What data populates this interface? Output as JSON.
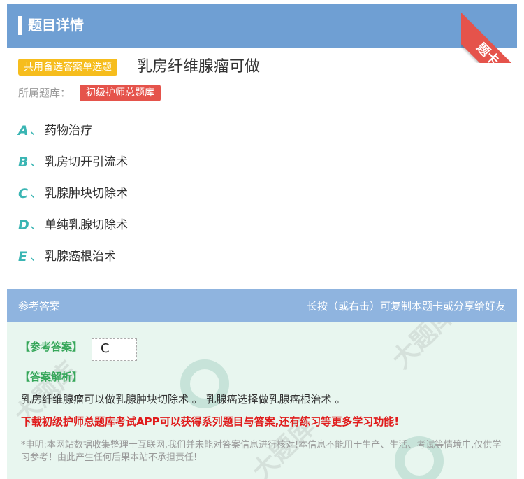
{
  "header": {
    "title": "题目详情",
    "corner_badge": "题卡"
  },
  "question": {
    "type_tag": "共用备选答案单选题",
    "title": "乳房纤维腺瘤可做",
    "bank_label": "所属题库：",
    "bank_name": "初级护师总题库"
  },
  "options": [
    {
      "letter": "A",
      "sep": "、",
      "text": "药物治疗"
    },
    {
      "letter": "B",
      "sep": "、",
      "text": "乳房切开引流术"
    },
    {
      "letter": "C",
      "sep": "、",
      "text": "乳腺肿块切除术"
    },
    {
      "letter": "D",
      "sep": "、",
      "text": "单纯乳腺切除术"
    },
    {
      "letter": "E",
      "sep": "、",
      "text": "乳腺癌根治术"
    }
  ],
  "answer_section": {
    "header_left": "参考答案",
    "header_right": "长按（或右击）可复制本题卡或分享给好友",
    "answer_label": "【参考答案】",
    "answer_value": "C",
    "analysis_label": "【答案解析】",
    "analysis_text": "乳房纤维腺瘤可以做乳腺肿块切除术 。 乳腺癌选择做乳腺癌根治术 。",
    "promo_text": "下载初级护师总题库考试APP可以获得系列题目与答案,还有练习等更多学习功能!",
    "disclaimer": "*申明:本网站数据收集整理于互联网,我们并未能对答案信息进行核对!本信息不能用于生产、生活、考试等情境中,仅供学习参考！由此产生任何后果本站不承担责任!"
  },
  "colors": {
    "header_blue": "#6f9fd3",
    "answer_header_blue": "#8fb4df",
    "tag_yellow": "#f6bd1d",
    "tag_red": "#e5534b",
    "option_teal": "#3ab5b3",
    "answer_green": "#35a659",
    "promo_red": "#e01b1b",
    "answer_bg": "#e8f6ef"
  }
}
